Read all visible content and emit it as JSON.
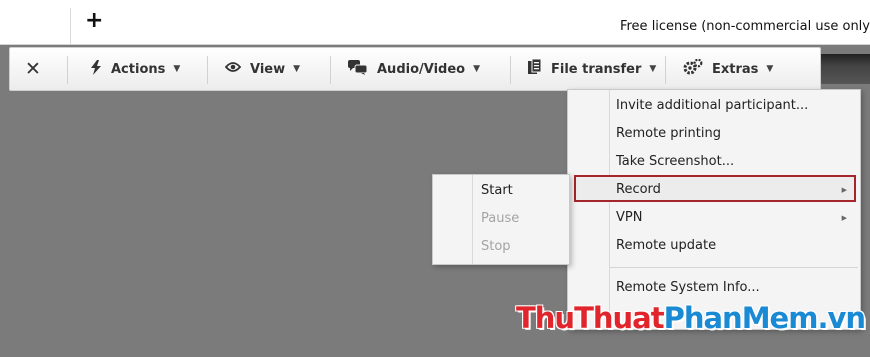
{
  "topbar": {
    "add_symbol": "+",
    "license_text": "Free license (non-commercial use only"
  },
  "toolbar": {
    "close_glyph": "✕",
    "actions": {
      "label": "Actions",
      "icon": "lightning-icon",
      "caret": "▼"
    },
    "view": {
      "label": "View",
      "icon": "eye-icon",
      "caret": "▼"
    },
    "audio_video": {
      "label": "Audio/Video",
      "icon": "chat-icon",
      "caret": "▼"
    },
    "file_transfer": {
      "label": "File transfer",
      "icon": "file-icon",
      "caret": "▼"
    },
    "extras": {
      "label": "Extras",
      "icon": "gears-icon",
      "caret": "▼"
    }
  },
  "extras_menu": {
    "invite": "Invite additional participant...",
    "remote_printing": "Remote printing",
    "screenshot": "Take Screenshot...",
    "record": "Record",
    "vpn": "VPN",
    "remote_update": "Remote update",
    "system_info": "Remote System Info...",
    "arrow": "▶"
  },
  "record_submenu": {
    "start": "Start",
    "pause": "Pause",
    "stop": "Stop"
  },
  "watermark": {
    "part1": "ThuThuat",
    "part2": "PhanMem",
    "part3": ".vn"
  },
  "colors": {
    "highlight_border": "#a5252a",
    "watermark_red": "#e0262c",
    "watermark_blue": "#1a8ad4"
  }
}
